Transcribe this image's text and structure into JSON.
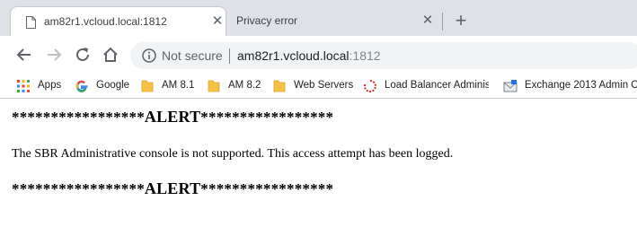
{
  "tabs": [
    {
      "title": "am82r1.vcloud.local:1812",
      "active": true
    },
    {
      "title": "Privacy error",
      "active": false
    }
  ],
  "omnibox": {
    "security_label": "Not secure",
    "url_host": "am82r1.vcloud.local",
    "url_port": ":1812"
  },
  "bookmarks": [
    {
      "label": "Apps",
      "icon": "apps-grid-icon"
    },
    {
      "label": "Google",
      "icon": "google-g-icon"
    },
    {
      "label": "AM 8.1",
      "icon": "folder-icon"
    },
    {
      "label": "AM 8.2",
      "icon": "folder-icon"
    },
    {
      "label": "Web Servers",
      "icon": "folder-icon"
    },
    {
      "label": "Load Balancer Administ",
      "icon": "loading-spinner-icon"
    },
    {
      "label": "Exchange 2013 Admin C",
      "icon": "exchange-envelope-icon"
    }
  ],
  "page": {
    "alert_stars": "*****************",
    "alert_word": "ALERT",
    "message": "The SBR Administrative console is not supported. This access attempt has been logged."
  },
  "colors": {
    "tabstrip_bg": "#dee1e6",
    "omnibox_bg": "#f1f3f4",
    "folder_yellow": "#f6c244",
    "spinner_red": "#d93025"
  }
}
